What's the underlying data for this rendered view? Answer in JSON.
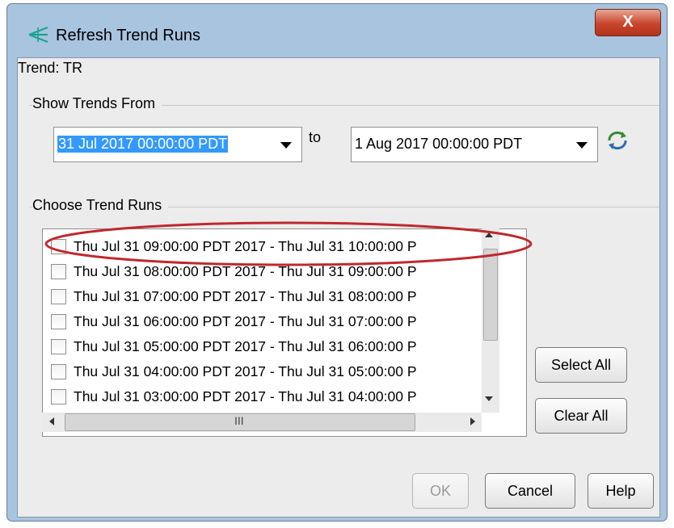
{
  "window": {
    "title": "Refresh Trend Runs",
    "close_label": "X"
  },
  "trend_label": "Trend: TR",
  "show_trends": {
    "group_label": "Show Trends From",
    "from_value": "31 Jul 2017 00:00:00 PDT",
    "to_label": "to",
    "to_value": "1 Aug 2017 00:00:00 PDT"
  },
  "choose_runs": {
    "group_label": "Choose Trend Runs",
    "rows": [
      "Thu Jul 31 09:00:00 PDT 2017 - Thu Jul 31 10:00:00 P",
      "Thu Jul 31 08:00:00 PDT 2017 - Thu Jul 31 09:00:00 P",
      "Thu Jul 31 07:00:00 PDT 2017 - Thu Jul 31 08:00:00 P",
      "Thu Jul 31 06:00:00 PDT 2017 - Thu Jul 31 07:00:00 P",
      "Thu Jul 31 05:00:00 PDT 2017 - Thu Jul 31 06:00:00 P",
      "Thu Jul 31 04:00:00 PDT 2017 - Thu Jul 31 05:00:00 P",
      "Thu Jul 31 03:00:00 PDT 2017 - Thu Jul 31 04:00:00 P"
    ],
    "hscroll_grip": "III"
  },
  "buttons": {
    "select_all": "Select All",
    "clear_all": "Clear All",
    "ok": "OK",
    "cancel": "Cancel",
    "help": "Help"
  },
  "colors": {
    "selection": "#3399ff",
    "annotation": "#c0282d",
    "window_frame": "#a9c4df",
    "close_button": "#c8452c"
  },
  "icons": {
    "app": "trend-app-icon",
    "refresh": "refresh-icon",
    "dropdown": "chevron-down-icon"
  }
}
